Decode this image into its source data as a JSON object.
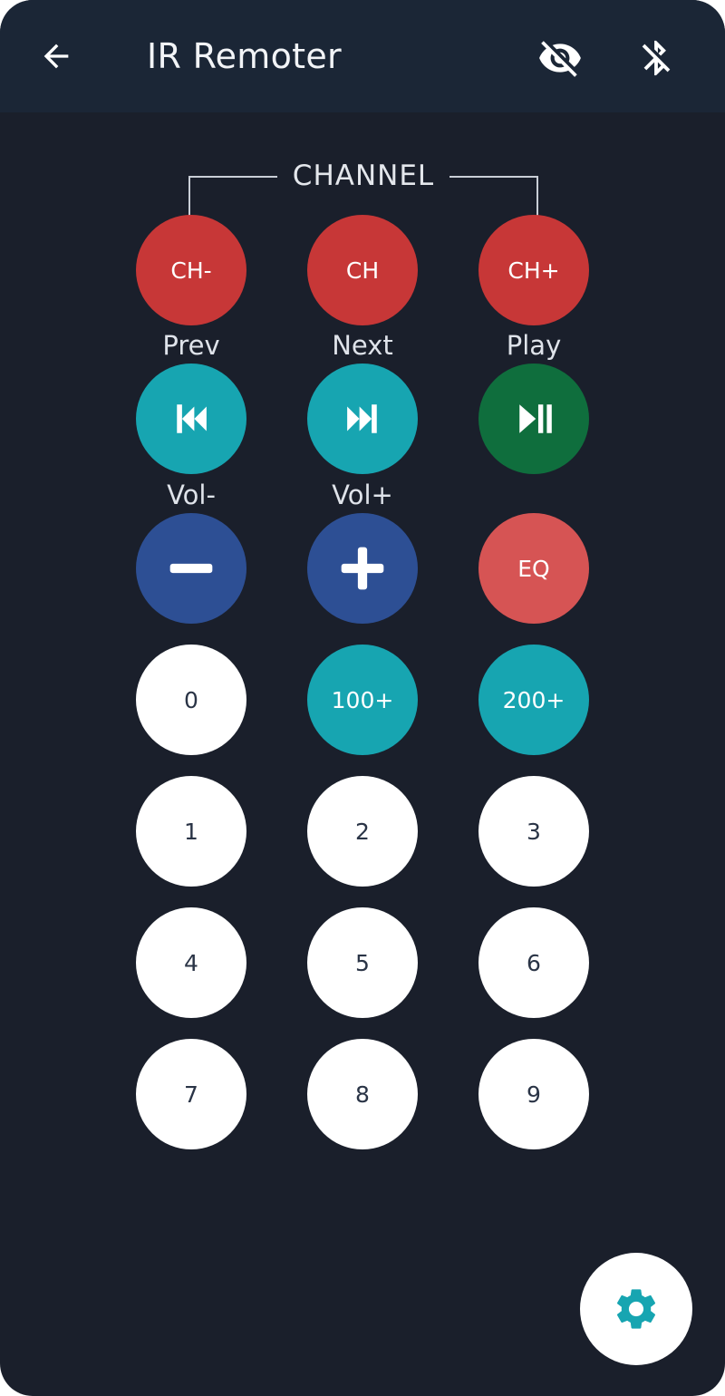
{
  "appbar": {
    "title": "IR Remoter",
    "back_icon": "arrow-back-icon",
    "visibility_icon": "eye-off-icon",
    "bluetooth_icon": "bluetooth-disabled-icon"
  },
  "channel_group": {
    "label": "CHANNEL"
  },
  "buttons": {
    "ch_minus": "CH-",
    "ch": "CH",
    "ch_plus": "CH+",
    "eq": "EQ",
    "num_0": "0",
    "num_100": "100+",
    "num_200": "200+",
    "num_1": "1",
    "num_2": "2",
    "num_3": "3",
    "num_4": "4",
    "num_5": "5",
    "num_6": "6",
    "num_7": "7",
    "num_8": "8",
    "num_9": "9"
  },
  "labels": {
    "prev": "Prev",
    "next": "Next",
    "play": "Play",
    "vol_minus": "Vol-",
    "vol_plus": "Vol+"
  },
  "fab": {
    "icon": "gear-icon"
  },
  "colors": {
    "background": "#1a1f2b",
    "appbar": "#1b2636",
    "channel_red": "#c73737",
    "eq_red": "#d65454",
    "teal": "#17a5b1",
    "play_green": "#0f6e3d",
    "volume_blue": "#2d4f94",
    "number_white": "#ffffff",
    "accent_teal": "#17a5b1"
  }
}
